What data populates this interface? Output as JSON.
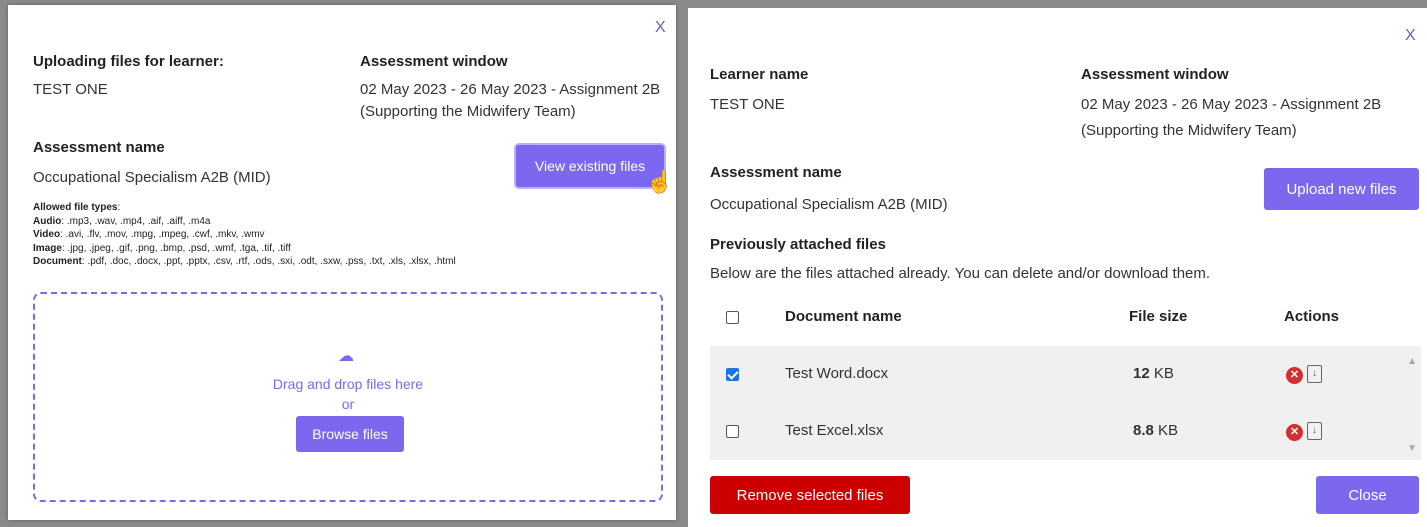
{
  "left": {
    "close": "X",
    "learner_label": "Uploading files for learner:",
    "learner_value": "TEST ONE",
    "window_label": "Assessment window",
    "window_value": "02 May 2023 - 26 May 2023 - Assignment 2B (Supporting the Midwifery Team)",
    "assessment_label": "Assessment name",
    "assessment_value": "Occupational Specialism A2B (MID)",
    "view_button": "View existing files",
    "allowed_title": "Allowed file types",
    "types": [
      {
        "label": "Audio",
        "value": ".mp3, .wav, .mp4, .aif, .aiff, .m4a"
      },
      {
        "label": "Video",
        "value": ".avi, .flv, .mov, .mpg, .mpeg, .cwf, .mkv, .wmv"
      },
      {
        "label": "Image",
        "value": ".jpg, .jpeg, .gif, .png, .bmp, .psd, .wmf, .tga, .tif, .tiff"
      },
      {
        "label": "Document",
        "value": ".pdf, .doc, .docx, .ppt, .pptx, .csv, .rtf, .ods, .sxi, .odt, .sxw, .pss, .txt, .xls, .xlsx, .html"
      }
    ],
    "drop_text": "Drag and drop files here",
    "or_text": "or",
    "browse_button": "Browse files"
  },
  "right": {
    "close": "X",
    "learner_label": "Learner name",
    "learner_value": "TEST ONE",
    "window_label": "Assessment window",
    "window_value": "02 May 2023 - 26 May 2023 - Assignment 2B (Supporting the Midwifery Team)",
    "assessment_label": "Assessment name",
    "assessment_value": "Occupational Specialism A2B (MID)",
    "upload_button": "Upload new files",
    "previous_label": "Previously attached files",
    "previous_desc": "Below are the files attached already. You can delete and/or download them.",
    "columns": {
      "name": "Document name",
      "size": "File size",
      "actions": "Actions"
    },
    "files": [
      {
        "name": "Test Word.docx",
        "size_num": "12",
        "size_unit": "KB",
        "checked": true
      },
      {
        "name": "Test Excel.xlsx",
        "size_num": "8.8",
        "size_unit": "KB",
        "checked": false
      }
    ],
    "remove_button": "Remove selected files",
    "close_button": "Close"
  },
  "colors": {
    "accent": "#7b68ee",
    "danger": "#cc0000",
    "checkbox": "#1a73e8"
  }
}
